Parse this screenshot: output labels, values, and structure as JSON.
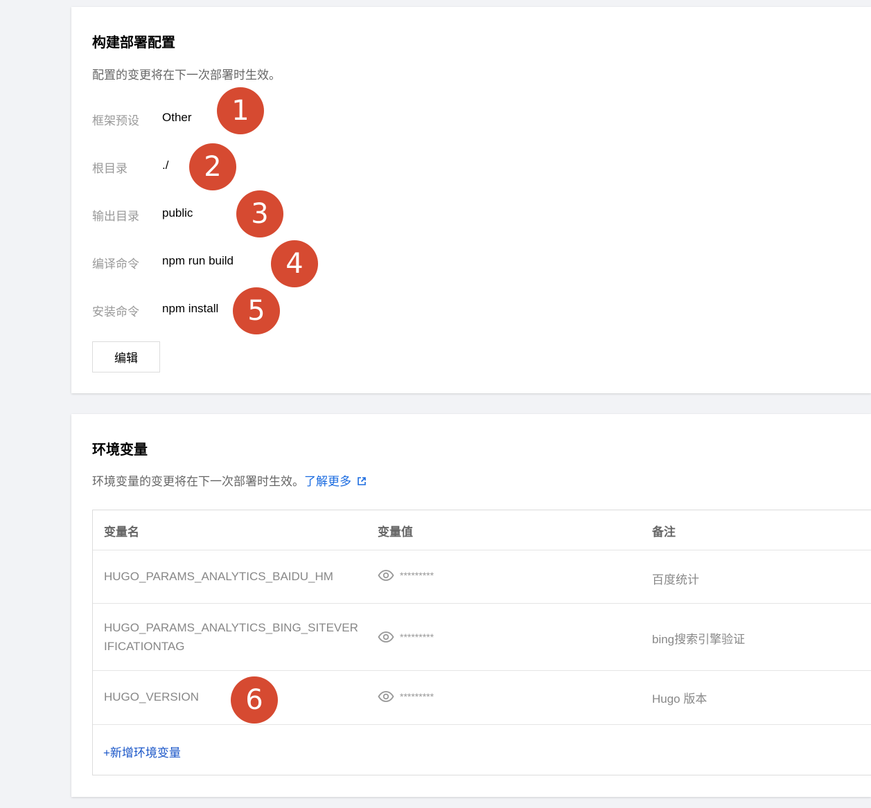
{
  "build": {
    "title": "构建部署配置",
    "desc": "配置的变更将在下一次部署时生效。",
    "fields": [
      {
        "label": "框架预设",
        "value": "Other"
      },
      {
        "label": "根目录",
        "value": "./"
      },
      {
        "label": "输出目录",
        "value": "public"
      },
      {
        "label": "编译命令",
        "value": "npm run build"
      },
      {
        "label": "安装命令",
        "value": "npm install"
      }
    ],
    "edit_label": "编辑"
  },
  "env": {
    "title": "环境变量",
    "desc": "环境变量的变更将在下一次部署时生效。",
    "learn_more": "了解更多",
    "columns": {
      "name": "变量名",
      "value": "变量值",
      "note": "备注"
    },
    "rows": [
      {
        "name": "HUGO_PARAMS_ANALYTICS_BAIDU_HM",
        "value": "*********",
        "note": "百度统计"
      },
      {
        "name": "HUGO_PARAMS_ANALYTICS_BING_SITEVERIFICATIONTAG",
        "value": "*********",
        "note": "bing搜索引擎验证"
      },
      {
        "name": "HUGO_VERSION",
        "value": "*********",
        "note": "Hugo 版本"
      }
    ],
    "add_label": "+新增环境变量"
  },
  "markers": [
    "1",
    "2",
    "3",
    "4",
    "5",
    "6"
  ],
  "colors": {
    "marker": "#d64a31",
    "link": "#1a6be0"
  }
}
